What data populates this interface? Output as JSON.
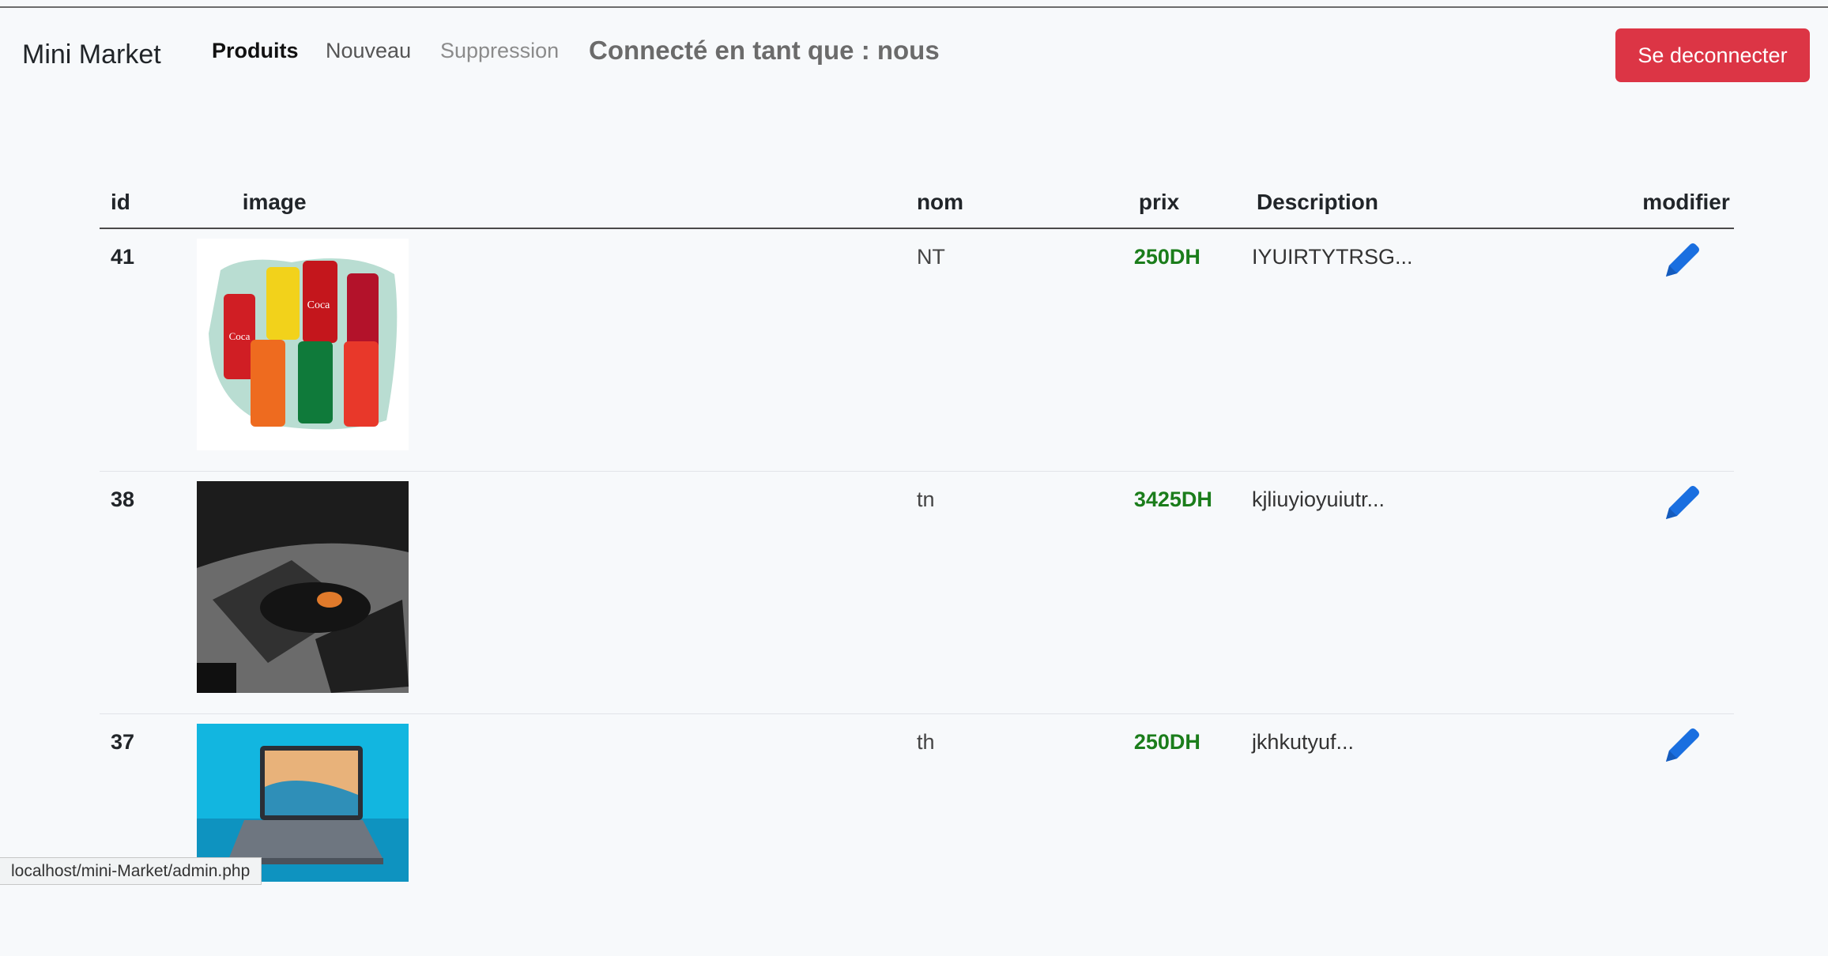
{
  "app": {
    "brand": "Mini Market",
    "nav": [
      {
        "label": "Produits"
      },
      {
        "label": "Nouveau"
      },
      {
        "label": "Suppression"
      }
    ],
    "user_label": "Connecté en tant que : nous",
    "logout_label": "Se deconnecter"
  },
  "table": {
    "headers": {
      "id": "id",
      "image": "image",
      "nom": "nom",
      "prix": "prix",
      "description": "Description",
      "modifier": "modifier"
    },
    "rows": [
      {
        "id": "41",
        "image": "soda-cans-photo",
        "nom": "NT",
        "prix": "250DH",
        "description": "IYUIRTYTRSG..."
      },
      {
        "id": "38",
        "image": "gaming-mouse-photo",
        "nom": "tn",
        "prix": "3425DH",
        "description": "kjliuyioyuiutr..."
      },
      {
        "id": "37",
        "image": "laptop-photo",
        "nom": "th",
        "prix": "250DH",
        "description": "jkhkutyuf..."
      }
    ]
  },
  "status_bar": {
    "url": "localhost/mini-Market/admin.php"
  },
  "colors": {
    "danger": "#dc3545",
    "price": "#1b7d1b",
    "edit_icon": "#1a6fe0"
  },
  "icons": {
    "edit": "pencil-icon"
  }
}
